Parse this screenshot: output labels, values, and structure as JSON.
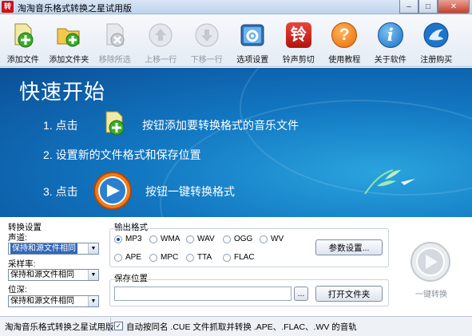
{
  "window": {
    "title": "淘淘音乐格式转换之星试用版",
    "app_icon_text": "转",
    "min": "–",
    "max": "□",
    "close": "✕"
  },
  "toolbar": {
    "items": [
      {
        "label": "添加文件",
        "icon": "add-file-icon",
        "enabled": true
      },
      {
        "label": "添加文件夹",
        "icon": "add-folder-icon",
        "enabled": true
      },
      {
        "label": "移除所选",
        "icon": "remove-icon",
        "enabled": false
      },
      {
        "label": "上移一行",
        "icon": "up-arrow-icon",
        "enabled": false
      },
      {
        "label": "下移一行",
        "icon": "down-arrow-icon",
        "enabled": false
      },
      {
        "label": "选项设置",
        "icon": "settings-icon",
        "enabled": true
      },
      {
        "label": "铃声剪切",
        "icon": "ringtone-icon",
        "enabled": true
      },
      {
        "label": "使用教程",
        "icon": "help-icon",
        "enabled": true
      },
      {
        "label": "关于软件",
        "icon": "info-icon",
        "enabled": true
      },
      {
        "label": "注册购买",
        "icon": "register-icon",
        "enabled": true
      }
    ],
    "ringtone_glyph": "铃",
    "help_glyph": "?",
    "info_glyph": "i"
  },
  "banner": {
    "title": "快速开始",
    "step1_num": "1. 点击",
    "step1_text": "按钮添加要转换格式的音乐文件",
    "step2": "2. 设置新的文件格式和保存位置",
    "step3_num": "3. 点击",
    "step3_text": "按钮一键转换格式"
  },
  "convert_settings": {
    "title": "转换设置",
    "channel_label": "声道:",
    "channel_value": "保持和源文件相同",
    "samplerate_label": "采样率:",
    "samplerate_value": "保持和源文件相同",
    "bitdepth_label": "位深:",
    "bitdepth_value": "保持和源文件相同"
  },
  "output_format": {
    "title": "输出格式",
    "options": [
      "MP3",
      "WMA",
      "WAV",
      "OGG",
      "WV",
      "APE",
      "MPC",
      "TTA",
      "FLAC"
    ],
    "selected": "MP3",
    "params_button": "参数设置..."
  },
  "save_location": {
    "title": "保存位置",
    "path_value": "",
    "browse_button": "...",
    "open_folder_button": "打开文件夹"
  },
  "convert_button": {
    "label": "一键转换"
  },
  "statusbar": {
    "text": "淘淘音乐格式转换之星试用版",
    "checkbox_checked": true,
    "checkbox_mark": "✓",
    "checkbox_label": "自动按同名 .CUE 文件抓取并转换 .APE、.FLAC、.WV 的音轨"
  }
}
